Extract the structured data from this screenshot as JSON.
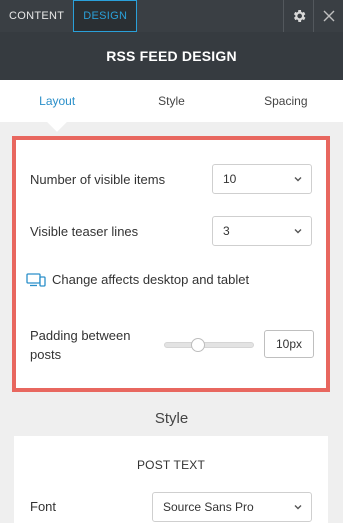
{
  "topbar": {
    "tabs": [
      {
        "label": "CONTENT",
        "active": false
      },
      {
        "label": "DESIGN",
        "active": true
      }
    ],
    "icons": [
      "gear-icon",
      "close-icon"
    ]
  },
  "header": {
    "title": "RSS FEED DESIGN"
  },
  "subtabs": [
    {
      "label": "Layout",
      "active": true
    },
    {
      "label": "Style",
      "active": false
    },
    {
      "label": "Spacing",
      "active": false
    }
  ],
  "layout": {
    "visible_items": {
      "label": "Number of visible items",
      "value": "10"
    },
    "teaser_lines": {
      "label": "Visible teaser lines",
      "value": "3"
    },
    "device_note": {
      "icon": "desktop-tablet-icon",
      "text": "Change affects desktop and tablet"
    },
    "padding": {
      "label": "Padding between posts",
      "value": "10px",
      "slider_level": 0.35
    }
  },
  "style": {
    "heading": "Style",
    "post_text": "POST TEXT",
    "font": {
      "label": "Font",
      "value": "Source Sans Pro"
    }
  },
  "colors": {
    "accent": "#2a8fc9",
    "highlight_border": "#e8675f",
    "topbar": "#3a3f44",
    "header": "#363b40"
  }
}
